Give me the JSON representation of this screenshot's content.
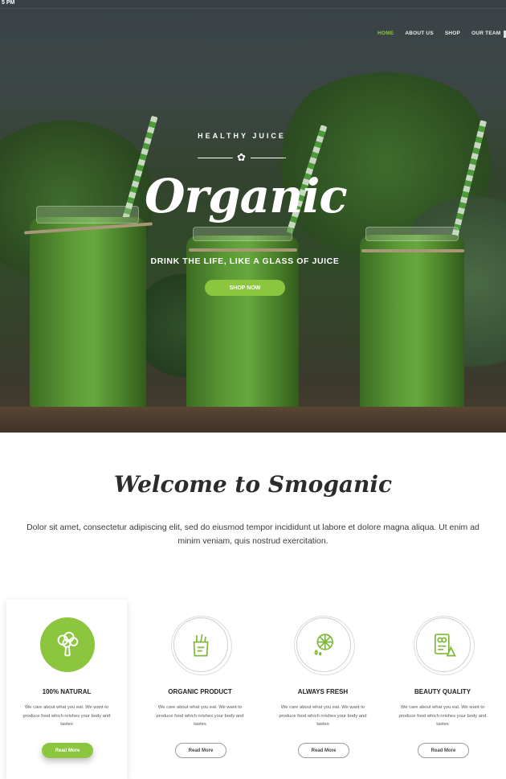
{
  "status": {
    "time": "5 PM"
  },
  "nav": {
    "items": [
      {
        "label": "HOME",
        "active": true
      },
      {
        "label": "ABOUT US",
        "active": false
      },
      {
        "label": "SHOP",
        "active": false
      },
      {
        "label": "OUR TEAM",
        "active": false
      }
    ]
  },
  "hero": {
    "badge": "HEALTHY JUICE",
    "title": "Organic",
    "subtitle": "DRINK THE LIFE, LIKE A GLASS OF JUICE",
    "cta": "SHOP NOW"
  },
  "welcome": {
    "title": "Welcome to Smoganic",
    "text": "Dolor sit amet, consectetur adipiscing elit, sed do eiusmod tempor incididunt ut labore et dolore magna aliqua. Ut enim ad minim veniam, quis nostrud exercitation."
  },
  "features": [
    {
      "title": "100% NATURAL",
      "text": "We care about what you eat. We want to produce food which nrishes your body and tastes",
      "button": "Read More",
      "icon": "broccoli-icon"
    },
    {
      "title": "ORGANIC PRODUCT",
      "text": "We care about what you eat. We want to produce food which nrishes your body and tastes",
      "button": "Read More",
      "icon": "grocery-bag-icon"
    },
    {
      "title": "ALWAYS FRESH",
      "text": "We care about what you eat. We want to produce food which nrishes your body and tastes",
      "button": "Read More",
      "icon": "citrus-slice-icon"
    },
    {
      "title": "BEAUTY QUALITY",
      "text": "We care about what you eat. We want to produce food which nrishes your body and tastes",
      "button": "Read More",
      "icon": "recipe-book-icon"
    }
  ],
  "colors": {
    "accent": "#8cc63f",
    "text": "#2b2b2b"
  }
}
